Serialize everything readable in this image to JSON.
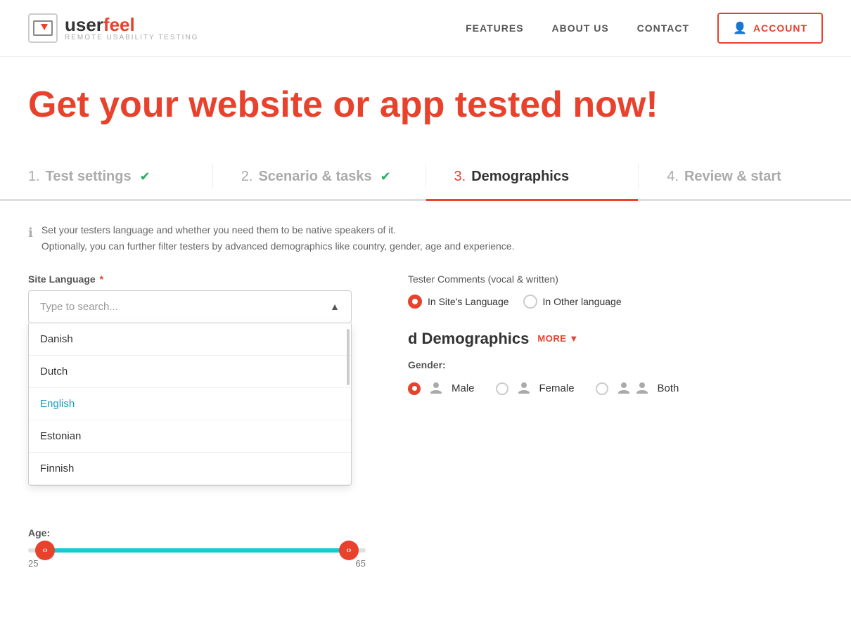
{
  "nav": {
    "logo_user": "user",
    "logo_feel": "feel",
    "logo_sub": "REMOTE USABILITY TESTING",
    "links": [
      "FEATURES",
      "ABOUT US",
      "CONTACT"
    ],
    "account_label": "ACCOUNT"
  },
  "hero": {
    "title": "Get your website or app tested now!"
  },
  "steps": [
    {
      "num": "1.",
      "label": "Test settings",
      "checked": true,
      "active": false
    },
    {
      "num": "2.",
      "label": "Scenario & tasks",
      "checked": true,
      "active": false
    },
    {
      "num": "3.",
      "label": "Demographics",
      "checked": false,
      "active": true
    },
    {
      "num": "4.",
      "label": "Review & start",
      "checked": false,
      "active": false
    }
  ],
  "info": {
    "line1": "Set your testers language and whether you need them to be native speakers of it.",
    "line2": "Optionally, you can further filter testers by advanced demographics like country, gender, age and experience."
  },
  "site_language": {
    "label": "Site Language",
    "placeholder": "Type to search...",
    "options": [
      "Danish",
      "Dutch",
      "English",
      "Estonian",
      "Finnish"
    ]
  },
  "tester_comments": {
    "label": "Tester Comments (vocal & written)",
    "option1": "In Site's Language",
    "option2": "In Other language"
  },
  "advanced_demographics": {
    "title": "d Demographics",
    "show_more": "MORE"
  },
  "age": {
    "label": "Age:",
    "min": "25",
    "max": "65"
  },
  "gender": {
    "label": "Gender:",
    "options": [
      "Male",
      "Female",
      "Both"
    ]
  },
  "icons": {
    "chevron_up": "▲",
    "chevron_down": "▼",
    "check_circle": "✔",
    "info": "ℹ",
    "left_arrow": "‹",
    "right_arrow": "›"
  }
}
